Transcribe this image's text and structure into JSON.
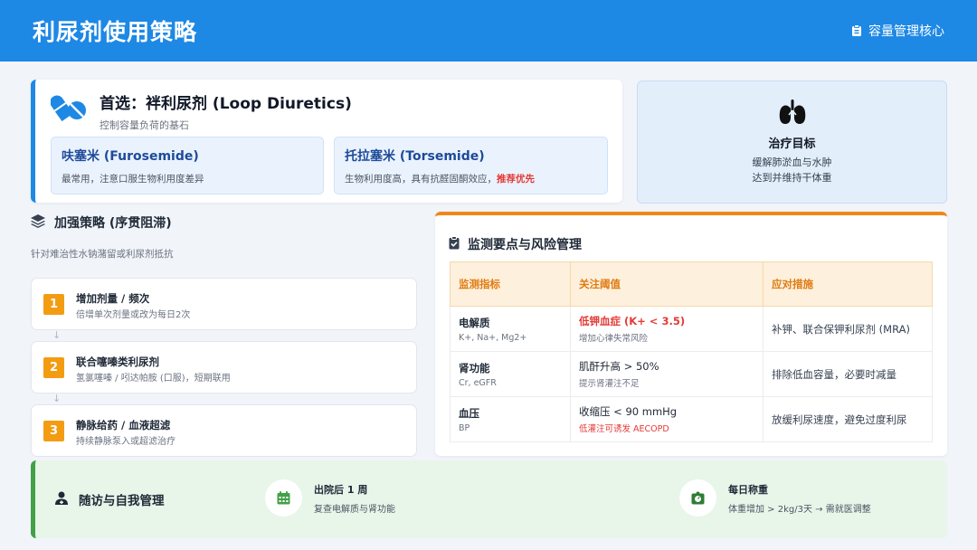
{
  "header": {
    "title": "利尿剂使用策略",
    "right_label": "容量管理核心"
  },
  "first_choice": {
    "title": "首选：袢利尿剂 (Loop Diuretics)",
    "subtitle": "控制容量负荷的基石",
    "drugs": [
      {
        "name": "呋塞米 (Furosemide)",
        "desc": "最常用，注意口服生物利用度差异",
        "recommend": ""
      },
      {
        "name": "托拉塞米 (Torsemide)",
        "desc": "生物利用度高，具有抗醛固酮效应，",
        "recommend": "推荐优先"
      }
    ]
  },
  "goal": {
    "title": "治疗目标",
    "line1": "缓解肺淤血与水肿",
    "line2": "达到并维持干体重"
  },
  "strategy": {
    "title": "加强策略 (序贯阻滞)",
    "subtitle": "针对难治性水钠潴留或利尿剂抵抗",
    "steps": [
      {
        "num": "1",
        "title": "增加剂量 / 频次",
        "desc": "倍增单次剂量或改为每日2次"
      },
      {
        "num": "2",
        "title": "联合噻嗪类利尿剂",
        "desc": "氢氯噻嗪 / 吲达帕胺 (口服)，短期联用"
      },
      {
        "num": "3",
        "title": "静脉给药 / 血液超滤",
        "desc": "持续静脉泵入或超滤治疗"
      }
    ],
    "arrow": "↓"
  },
  "monitoring": {
    "title": "监测要点与风险管理",
    "headers": [
      "监测指标",
      "关注阈值",
      "应对措施"
    ],
    "rows": [
      {
        "indicator": "电解质",
        "indicator_sub": "K+, Na+, Mg2+",
        "threshold": "低钾血症 (K+ < 3.5)",
        "threshold_sub": "增加心律失常风险",
        "action": "补钾、联合保钾利尿剂 (MRA)"
      },
      {
        "indicator": "肾功能",
        "indicator_sub": "Cr, eGFR",
        "threshold": "肌酐升高 > 50%",
        "threshold_sub": "提示肾灌注不足",
        "action": "排除低血容量，必要时减量"
      },
      {
        "indicator": "血压",
        "indicator_sub": "BP",
        "threshold": "收缩压 < 90 mmHg",
        "threshold_sub": "低灌注可诱发 AECOPD",
        "action": "放缓利尿速度，避免过度利尿"
      }
    ]
  },
  "follow_up": {
    "title": "随访与自我管理",
    "items": [
      {
        "title": "出院后 1 周",
        "desc": "复查电解质与肾功能",
        "icon": "calendar-icon"
      },
      {
        "title": "每日称重",
        "desc": "体重增加 > 2kg/3天 → 需就医调整",
        "icon": "weight-icon"
      }
    ]
  },
  "colors": {
    "primary": "#1e88e5",
    "accent_orange": "#f39c12",
    "alert_red": "#e53935",
    "success_green": "#43a047"
  }
}
